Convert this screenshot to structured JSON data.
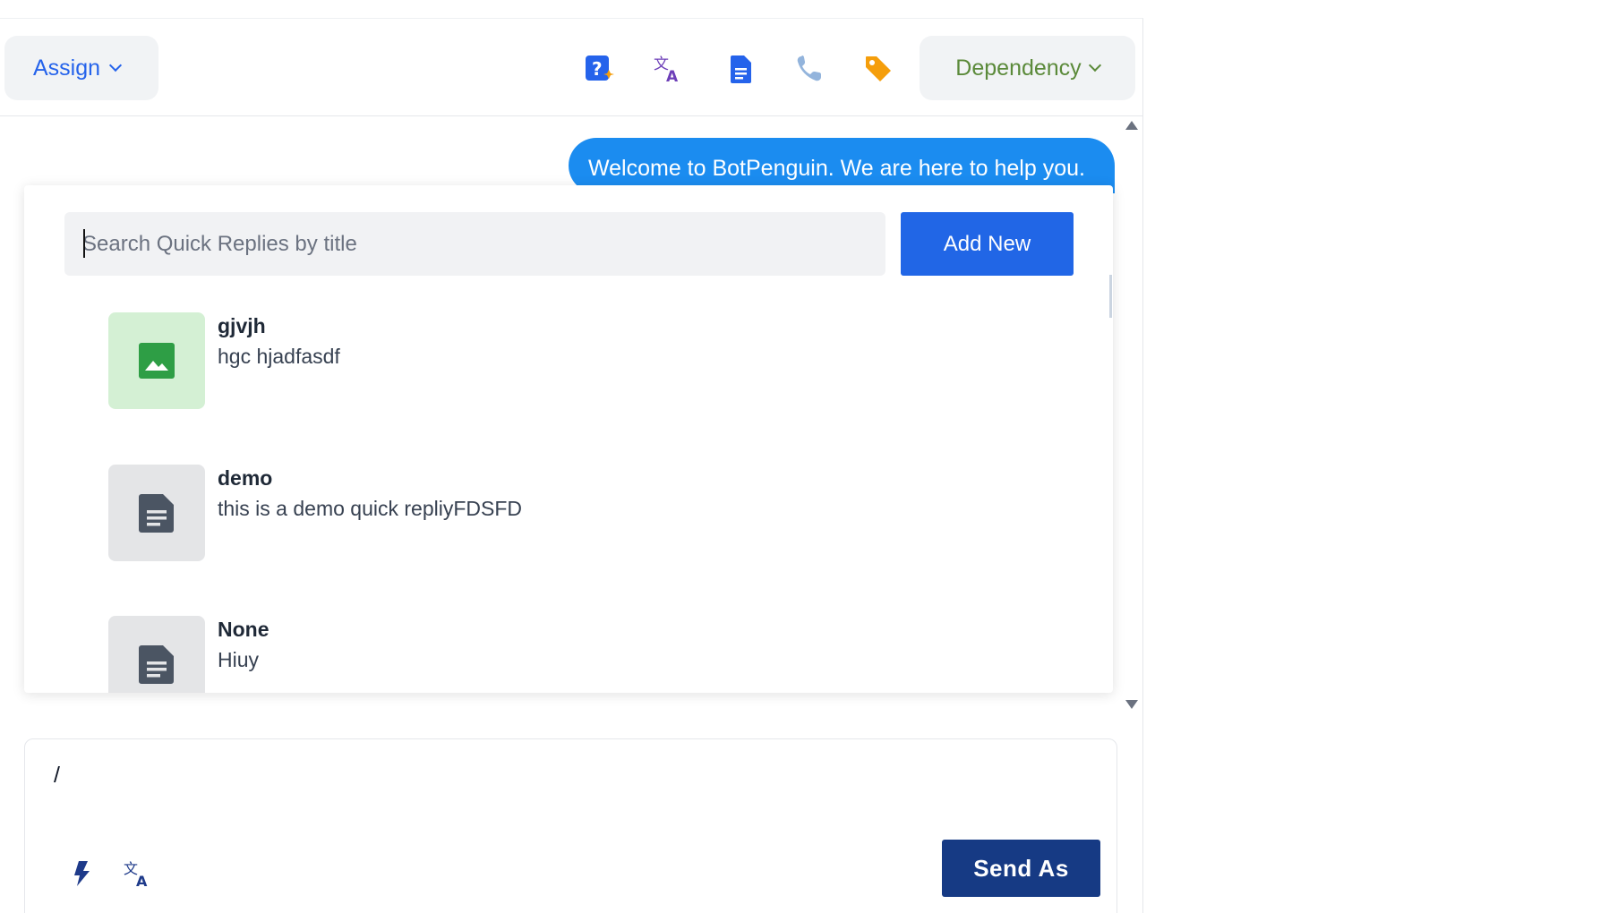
{
  "header": {
    "assign_label": "Assign",
    "dependency_label": "Dependency",
    "toolbar_icons": [
      "ai-question-icon",
      "translate-icon",
      "document-icon",
      "phone-icon",
      "tag-icon"
    ]
  },
  "chat": {
    "messages": [
      {
        "text": "Welcome to BotPenguin. We are here to help you.",
        "side": "right"
      }
    ]
  },
  "quick_replies": {
    "search_placeholder": "Search Quick Replies by title",
    "search_value": "",
    "add_new_label": "Add New",
    "items": [
      {
        "title": "gjvjh",
        "text": "hgc hjadfasdf",
        "icon": "image-icon"
      },
      {
        "title": "demo",
        "text": "this is a demo quick repliyFDSFD",
        "icon": "document-icon"
      },
      {
        "title": "None",
        "text": "Hiuy",
        "icon": "document-icon"
      }
    ]
  },
  "composer": {
    "value": "/",
    "send_label": "Send As"
  },
  "colors": {
    "primary": "#2166e6",
    "bubble": "#1b8cf0",
    "send": "#163a84",
    "dependency": "#5b8a3a",
    "tag": "#f59e0b"
  }
}
